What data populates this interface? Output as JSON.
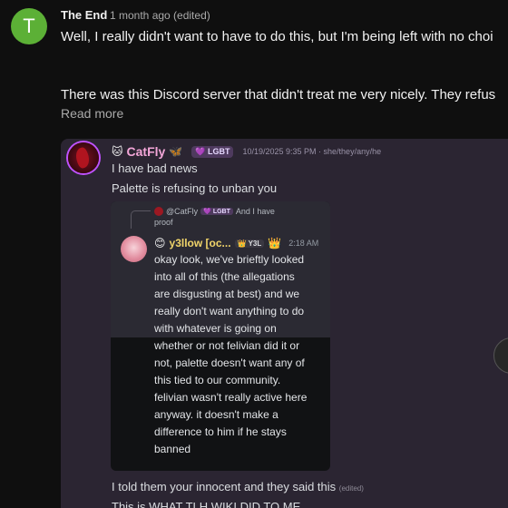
{
  "comment": {
    "avatar_letter": "T",
    "avatar_color": "#5cb036",
    "author": "The End",
    "meta": "1 month ago (edited)",
    "paragraph1": "Well, I really didn't want to have to do this, but I'm being left with no choi",
    "paragraph2": "There was this Discord server that didn't treat me very nicely. They refus",
    "read_more": "Read more"
  },
  "embed": {
    "username": "CatFly",
    "badge": "LGBT",
    "timestamp": "10/19/2025 9:35 PM · she/they/any/he",
    "lines": [
      "I have bad news",
      "Palette is refusing to unban you"
    ],
    "bottom_lines": [
      "I told them your innocent and they said this",
      "This is WHAT TLH WIKI DID TO ME"
    ],
    "edited": "(edited)",
    "inner": {
      "reply_user": "@CatFly",
      "reply_badge": "LGBT",
      "reply_text": "And I have",
      "reply_text2": "proof",
      "author": "y3llow [oc...",
      "tag": "Y3L",
      "time": "2:18 AM",
      "message": "okay look, we've brieftly looked\ninto all of this (the allegations\nare disgusting at best) and we\nreally don't want anything to do\nwith whatever is going on\nwhether or not felivian did it or\nnot, palette doesn't want any of\nthis tied to our community.\nfelivian wasn't really active here\nanyway. it doesn't make a\ndifference to him if he stays\nbanned"
    }
  }
}
